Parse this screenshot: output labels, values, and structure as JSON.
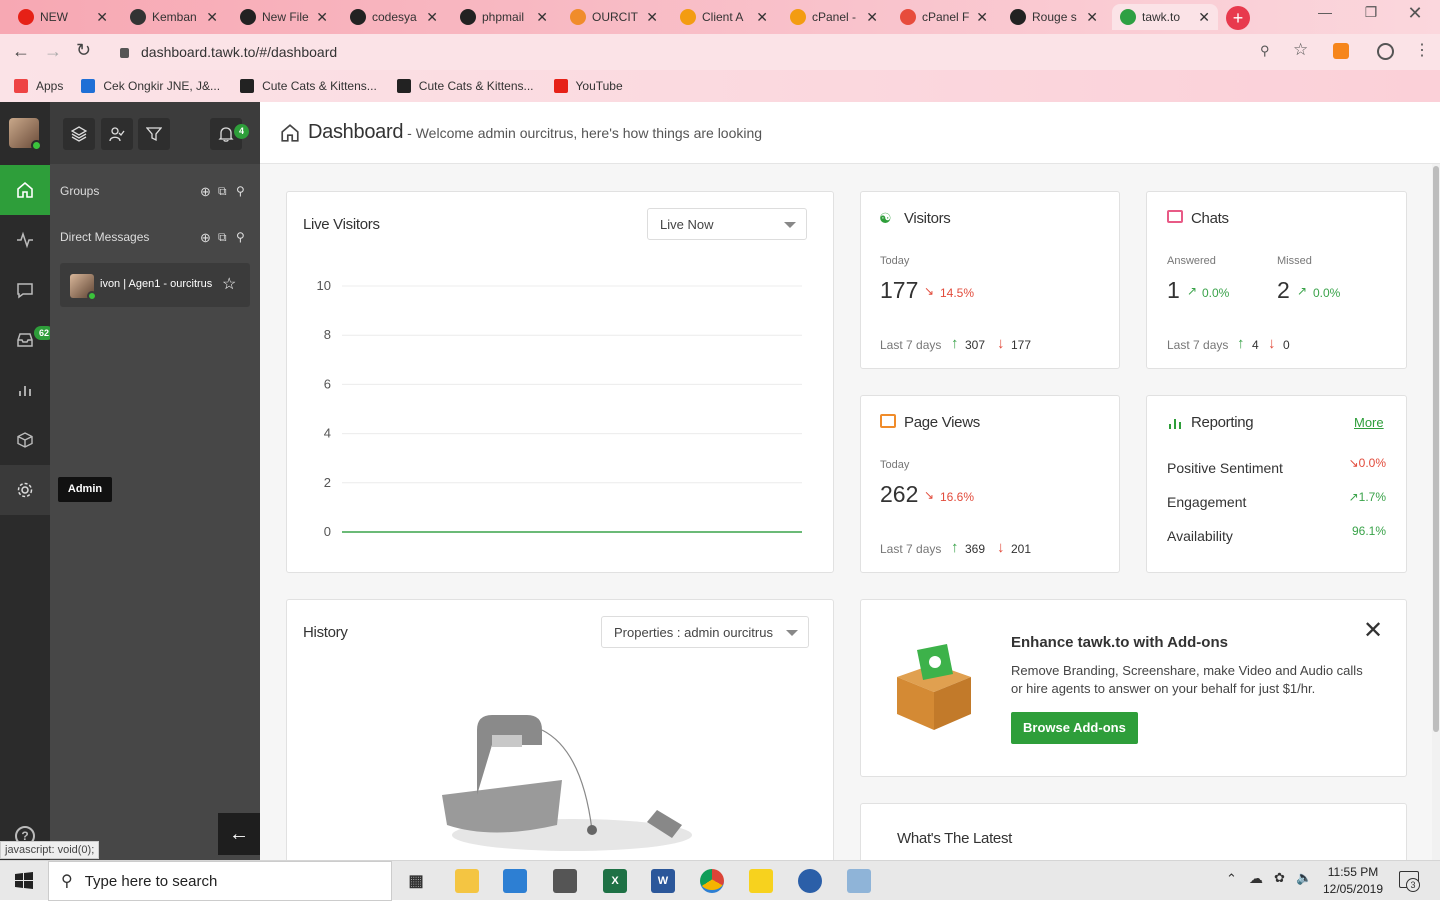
{
  "browser": {
    "tabs": [
      {
        "title": "NEW",
        "icon": "youtube-icon",
        "color": "#e62117"
      },
      {
        "title": "Kemban",
        "icon": "hacker-icon",
        "color": "#333333"
      },
      {
        "title": "New File",
        "icon": "github-icon",
        "color": "#222222"
      },
      {
        "title": "codesya",
        "icon": "github-icon",
        "color": "#222222"
      },
      {
        "title": "phpmail",
        "icon": "github-icon",
        "color": "#222222"
      },
      {
        "title": "OURCIT",
        "icon": "orange-app-icon",
        "color": "#f08c2b"
      },
      {
        "title": "Client A",
        "icon": "cpanel-icon",
        "color": "#f39c12"
      },
      {
        "title": "cPanel -",
        "icon": "cpanel-icon",
        "color": "#f39c12"
      },
      {
        "title": "cPanel F",
        "icon": "cpanel-icon",
        "color": "#e74c3c"
      },
      {
        "title": "Rouge s",
        "icon": "github-icon",
        "color": "#222222"
      },
      {
        "title": "tawk.to",
        "icon": "tawk-icon",
        "color": "#2ea043"
      }
    ],
    "url": "dashboard.tawk.to/#/dashboard",
    "bookmarks": [
      {
        "label": "Apps",
        "color": "#e44"
      },
      {
        "label": "Cek Ongkir JNE, J&...",
        "color": "#1f6fd6"
      },
      {
        "label": "Cute Cats & Kittens...",
        "color": "#222"
      },
      {
        "label": "Cute Cats & Kittens...",
        "color": "#222"
      },
      {
        "label": "YouTube",
        "color": "#e62117"
      }
    ]
  },
  "rail": {
    "inbox_badge": "62",
    "admin_tooltip": "Admin"
  },
  "panel": {
    "notif_badge": "4",
    "groups_label": "Groups",
    "dm_label": "Direct Messages",
    "dm_item": "ivon | Agen1 - ourcitrus"
  },
  "header": {
    "title": "Dashboard",
    "subtitle": " - Welcome admin ourcitrus, here's how things are looking"
  },
  "live_visitors": {
    "title": "Live Visitors",
    "dropdown": "Live Now"
  },
  "chart_data": {
    "type": "line",
    "title": "Live Visitors",
    "ylim": [
      0,
      10
    ],
    "yticks": [
      0,
      2,
      4,
      6,
      8,
      10
    ],
    "series": [
      {
        "values": [
          0,
          0,
          0,
          0,
          0,
          0,
          0,
          0,
          0,
          0,
          0
        ]
      }
    ],
    "grid": true,
    "line_color": "#3aa34a"
  },
  "visitors": {
    "title": "Visitors",
    "today_label": "Today",
    "today_value": "177",
    "change": "14.5%",
    "last7_label": "Last 7 days",
    "up_value": "307",
    "down_value": "177"
  },
  "chats": {
    "title": "Chats",
    "answered_label": "Answered",
    "answered_value": "1",
    "answered_change": "0.0%",
    "missed_label": "Missed",
    "missed_value": "2",
    "missed_change": "0.0%",
    "last7_label": "Last 7 days",
    "up_value": "4",
    "down_value": "0"
  },
  "page_views": {
    "title": "Page Views",
    "today_label": "Today",
    "today_value": "262",
    "change": "16.6%",
    "last7_label": "Last 7 days",
    "up_value": "369",
    "down_value": "201"
  },
  "reporting": {
    "title": "Reporting",
    "more": "More",
    "rows": [
      {
        "label": "Positive Sentiment",
        "value": "0.0%"
      },
      {
        "label": "Engagement",
        "value": "1.7%"
      },
      {
        "label": "Availability",
        "value": "96.1%"
      }
    ]
  },
  "history": {
    "title": "History",
    "dropdown": "Properties : admin ourcitrus"
  },
  "addons": {
    "title": "Enhance tawk.to with Add-ons",
    "body": "Remove Branding, Screenshare, make Video and Audio calls or hire agents to answer on your behalf for just $1/hr.",
    "button": "Browse Add-ons"
  },
  "latest": {
    "title": "What's The Latest"
  },
  "status_bar": "javascript: void(0);",
  "taskbar": {
    "search_placeholder": "Type here to search",
    "time": "11:55 PM",
    "date": "12/05/2019",
    "notif_count": "3"
  },
  "colors": {
    "accent": "#2ea043",
    "rail": "#2b2b2b",
    "panel": "#474747"
  }
}
